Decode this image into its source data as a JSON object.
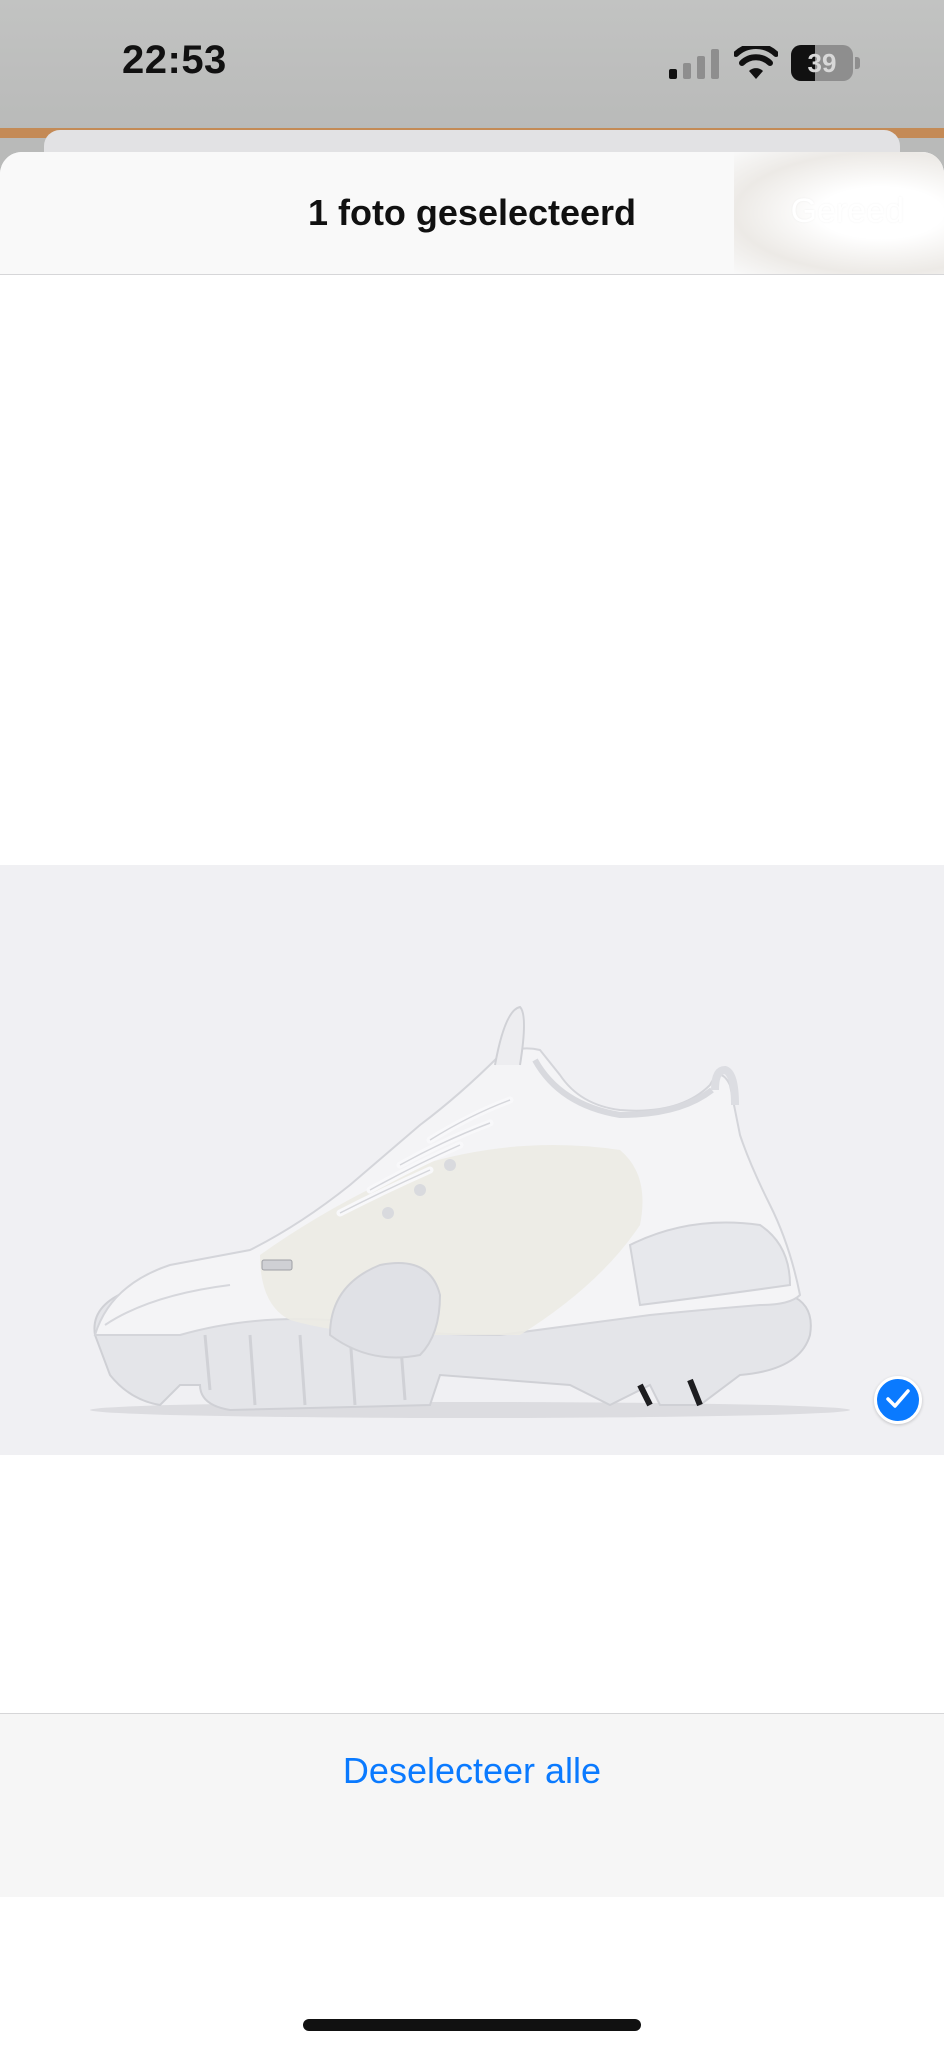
{
  "status_bar": {
    "time": "22:53",
    "battery_level": "39",
    "battery_fraction": 0.39,
    "signal_bars": 1,
    "icons": [
      "signal-icon",
      "wifi-icon",
      "battery-icon"
    ]
  },
  "header": {
    "title": "1 foto geselecteerd",
    "done_label": "Gereed"
  },
  "photos": [
    {
      "selected": true,
      "icon": "checkmark-icon"
    }
  ],
  "toolbar": {
    "deselect_label": "Deselecteer alle"
  },
  "colors": {
    "accent": "#0a7aff",
    "battery_text": "#d8d8d8"
  }
}
